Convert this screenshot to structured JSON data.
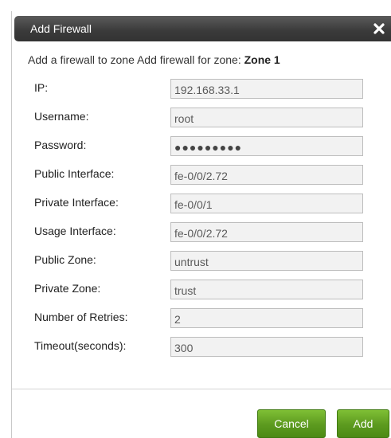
{
  "dialog": {
    "title": "Add Firewall",
    "close_icon": "close-icon",
    "subtitle_prefix": "Add a firewall to zone Add firewall for zone: ",
    "zone_name": "Zone 1"
  },
  "form": {
    "fields": [
      {
        "label": "IP:",
        "value": "192.168.33.1"
      },
      {
        "label": "Username:",
        "value": "root"
      },
      {
        "label": "Password:",
        "value": "●●●●●●●●●"
      },
      {
        "label": "Public Interface:",
        "value": "fe-0/0/2.72"
      },
      {
        "label": "Private Interface:",
        "value": "fe-0/0/1"
      },
      {
        "label": "Usage Interface:",
        "value": "fe-0/0/2.72"
      },
      {
        "label": "Public Zone:",
        "value": "untrust"
      },
      {
        "label": "Private Zone:",
        "value": "trust"
      },
      {
        "label": "Number of Retries:",
        "value": "2"
      },
      {
        "label": "Timeout(seconds):",
        "value": "300"
      }
    ]
  },
  "buttons": {
    "cancel_label": "Cancel",
    "add_label": "Add"
  },
  "colors": {
    "titlebar": "#3a3a3a",
    "button_green": "#5c9a1f",
    "input_bg": "#f2f2f2"
  }
}
